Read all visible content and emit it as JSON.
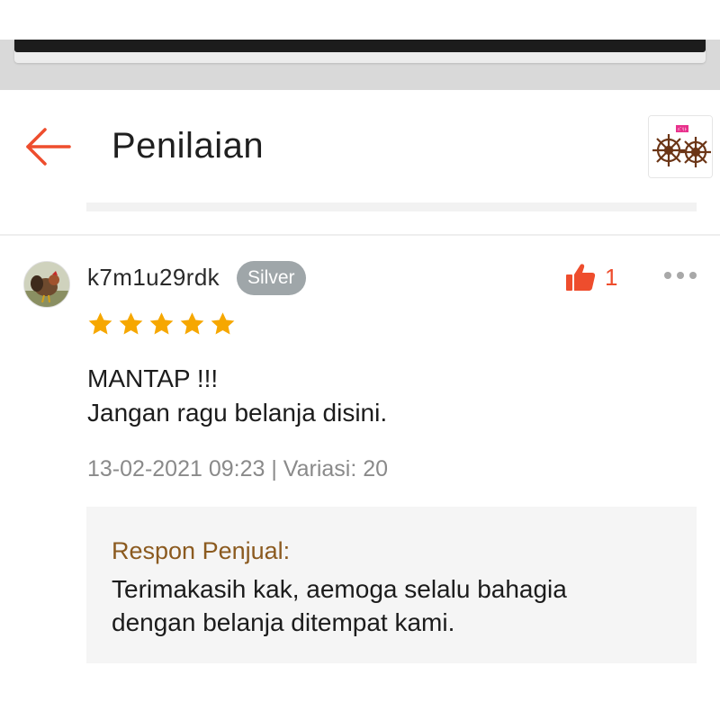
{
  "header": {
    "title": "Penilaian",
    "back_icon": "arrow-left-icon",
    "accent_color": "#ee4d2d",
    "thumbnail_badge": "ﾊﾞﾘﾄ"
  },
  "review": {
    "username": "k7m1u29rdk",
    "badge": "Silver",
    "likes": "1",
    "rating": 5,
    "comment_lines": [
      "MANTAP !!!",
      "Jangan ragu belanja disini."
    ],
    "meta": "13-02-2021 09:23 | Variasi: 20",
    "seller_response": {
      "title": "Respon Penjual:",
      "lines": [
        "Terimakasih kak, aemoga selalu bahagia",
        "dengan belanja ditempat kami."
      ]
    }
  },
  "colors": {
    "star": "#f6a700",
    "like": "#ee4d2d",
    "badge": "#9fa6a9",
    "response_title": "#8b5a1f"
  }
}
